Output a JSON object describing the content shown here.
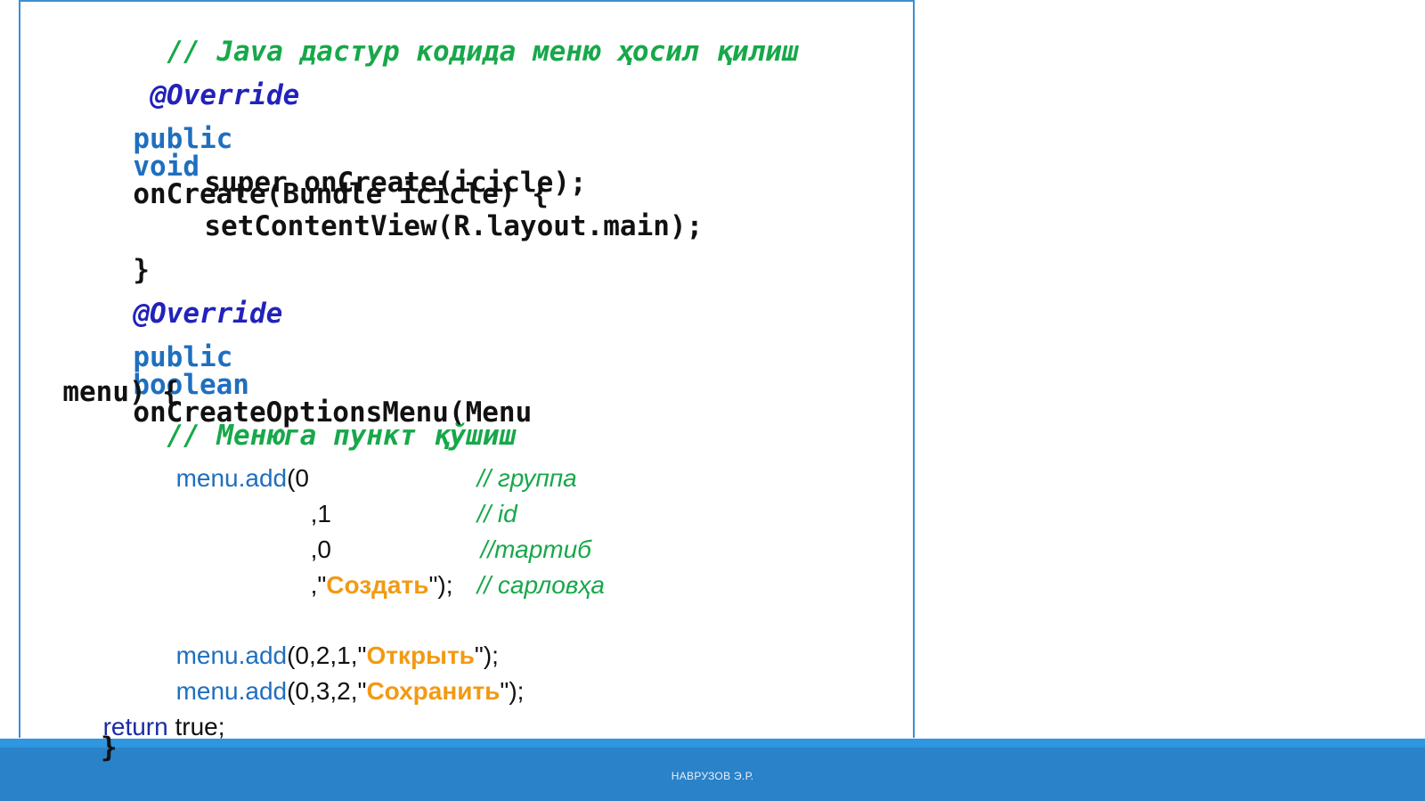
{
  "code": {
    "l1": "// Java дастур кодида меню ҳосил қилиш",
    "l2": "@Override",
    "l3_kw1": "public",
    "l3_kw2": "void",
    "l3_rest": "onCreate(Bundle icicle) {",
    "l4": "super.onCreate(icicle);",
    "l5": "setContentView(R.layout.main);",
    "l6": "}",
    "l7": "@Override",
    "l8_kw1": "public",
    "l8_kw2": "boolean",
    "l8_rest": "onCreateOptionsMenu(Menu",
    "l9": "menu) {",
    "l10": "// Менюга пункт қўшиш",
    "l11_method": "menu.add",
    "l11_args": "(0",
    "l11_comment": "// группа",
    "l12_args": ",1",
    "l12_comment": "// id",
    "l13_args": ",0",
    "l13_comment": "//тартиб",
    "l14_pre": ",\"",
    "l14_str": "Создать",
    "l14_post": "\");",
    "l14_comment": "// сарловҳа",
    "l15_method": "menu.add",
    "l15_pre": "(0,2,1,\"",
    "l15_str": "Открыть",
    "l15_post": "\");",
    "l16_method": "menu.add",
    "l16_pre": "(0,3,2,\"",
    "l16_str": "Сохранить",
    "l16_post": "\");",
    "l17_kw": "return",
    "l17_rest": " true;",
    "l18": "}"
  },
  "footer": {
    "author": "НАВРУЗОВ Э.Р."
  },
  "colors": {
    "comment": "#17a84a",
    "annotation": "#2222bb",
    "keyword": "#1f6fbf",
    "string": "#f29a14",
    "footer": "#2a82c9",
    "frame": "#3d8fd1"
  }
}
